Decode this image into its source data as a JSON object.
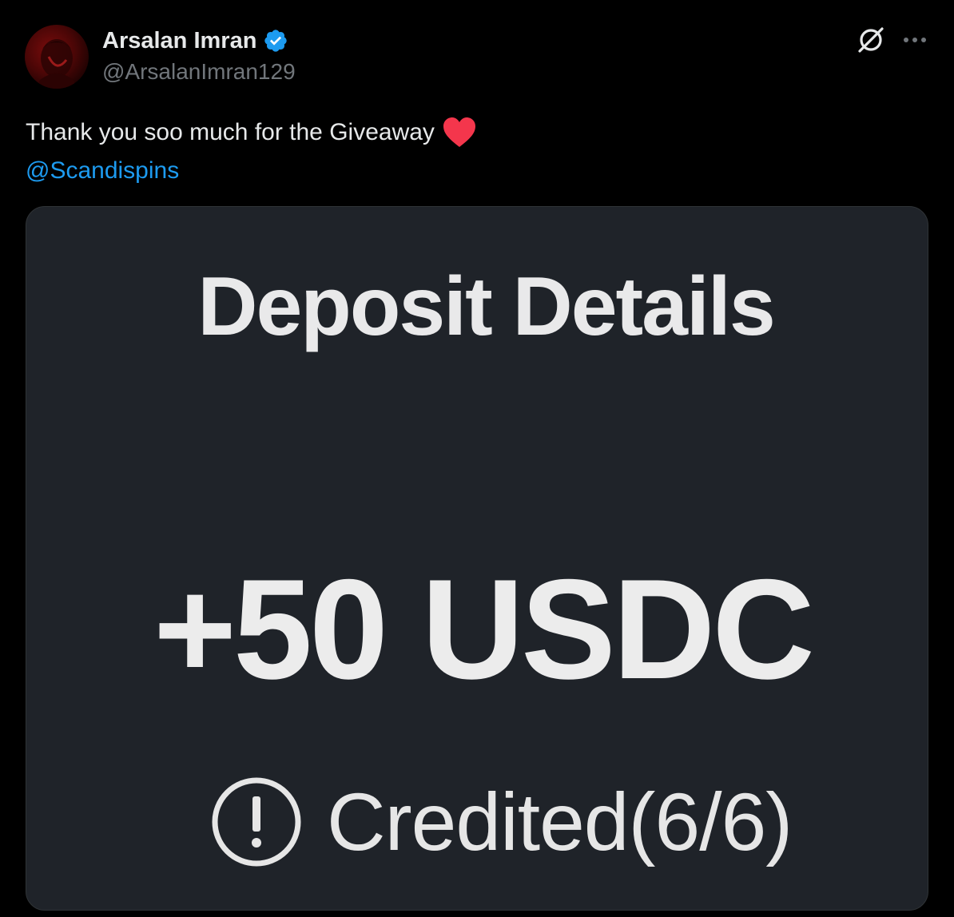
{
  "author": {
    "display_name": "Arsalan Imran",
    "handle": "@ArsalanImran129",
    "verified": true,
    "avatar_icon": "avatar-photo"
  },
  "header_actions": {
    "grok_icon": "grok-icon",
    "more_icon": "more-icon"
  },
  "tweet": {
    "text": "Thank you soo much for the Giveaway",
    "emoji": "heart-icon",
    "mention": "@Scandispins"
  },
  "media": {
    "title": "Deposit Details",
    "amount": "+50 USDC",
    "status_icon": "alert-circle-icon",
    "status": "Credited(6/6)"
  },
  "colors": {
    "background": "#000000",
    "text": "#e7e9ea",
    "secondary_text": "#71767b",
    "link": "#1d9bf0",
    "verified": "#1d9bf0",
    "heart": "#f4364c",
    "card_background": "#1f2329"
  }
}
